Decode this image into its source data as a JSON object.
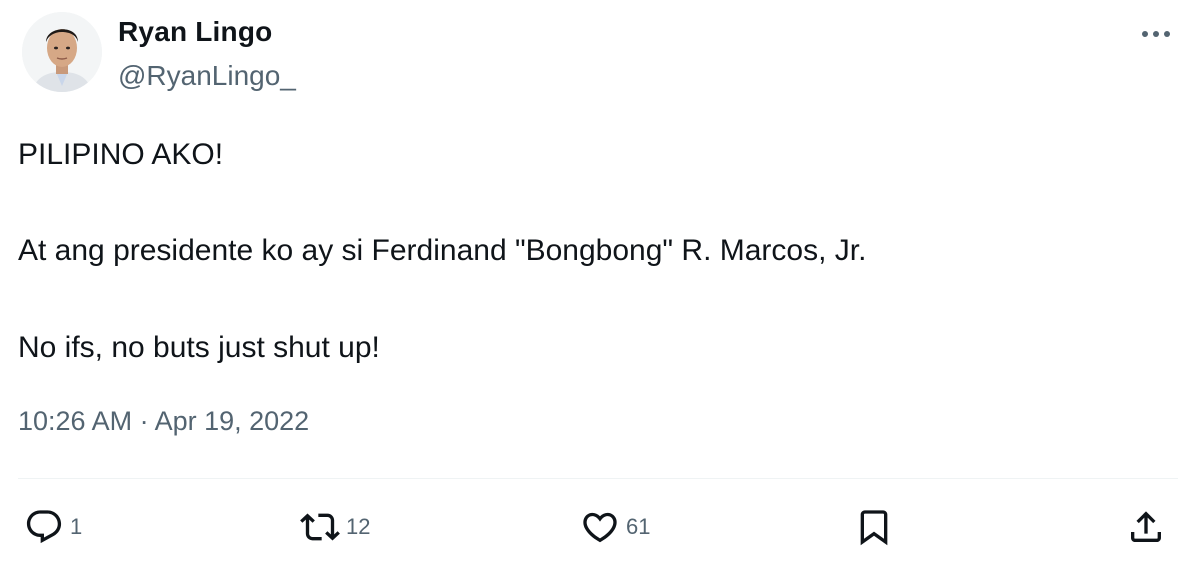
{
  "tweet": {
    "author": {
      "display_name": "Ryan Lingo",
      "handle": "@RyanLingo_"
    },
    "body": {
      "line1": "PILIPINO AKO!",
      "line2": "At ang presidente ko ay si Ferdinand \"Bongbong\" R. Marcos, Jr.",
      "line3": "No ifs, no buts just shut up!"
    },
    "timestamp": "10:26 AM · Apr 19, 2022",
    "actions": {
      "reply_count": "1",
      "retweet_count": "12",
      "like_count": "61"
    },
    "icons": {
      "more": "more-horizontal-icon",
      "reply": "reply-icon",
      "retweet": "retweet-icon",
      "like": "heart-icon",
      "bookmark": "bookmark-icon",
      "share": "share-icon"
    },
    "colors": {
      "text_primary": "#0f1419",
      "text_secondary": "#536471",
      "divider": "#eff3f4"
    }
  }
}
